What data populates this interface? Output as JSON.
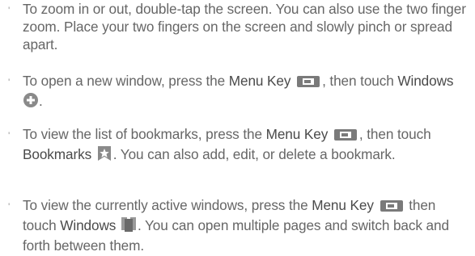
{
  "bullet_char": "'",
  "items": [
    {
      "text": "To zoom in or out, double-tap the screen. You can also use the two finger zoom. Place your two fingers on the screen and slowly pinch or spread apart."
    },
    {
      "pre": "To open a new window, press the ",
      "menu_key": "Menu Key",
      "mid": ", then touch ",
      "target": "Windows",
      "post": "."
    },
    {
      "pre": "To view the list of bookmarks, press the ",
      "menu_key": "Menu Key",
      "mid": ", then touch ",
      "target": "Bookmarks",
      "post": ". You can also add, edit, or delete a bookmark."
    },
    {
      "pre": "To view the currently active windows, press the ",
      "menu_key": "Menu Key",
      "mid": " then touch ",
      "target": "Windows",
      "post": ". You can open multiple pages and switch back and forth between them."
    }
  ],
  "icons": {
    "menu_key": "menu-key-icon",
    "new_window": "plus-circle-icon",
    "bookmarks": "bookmark-star-icon",
    "windows": "windows-stack-icon"
  },
  "colors": {
    "text": "#666666",
    "emphasis": "#4a4a4a",
    "icon_gray": "#7a7a7a"
  }
}
